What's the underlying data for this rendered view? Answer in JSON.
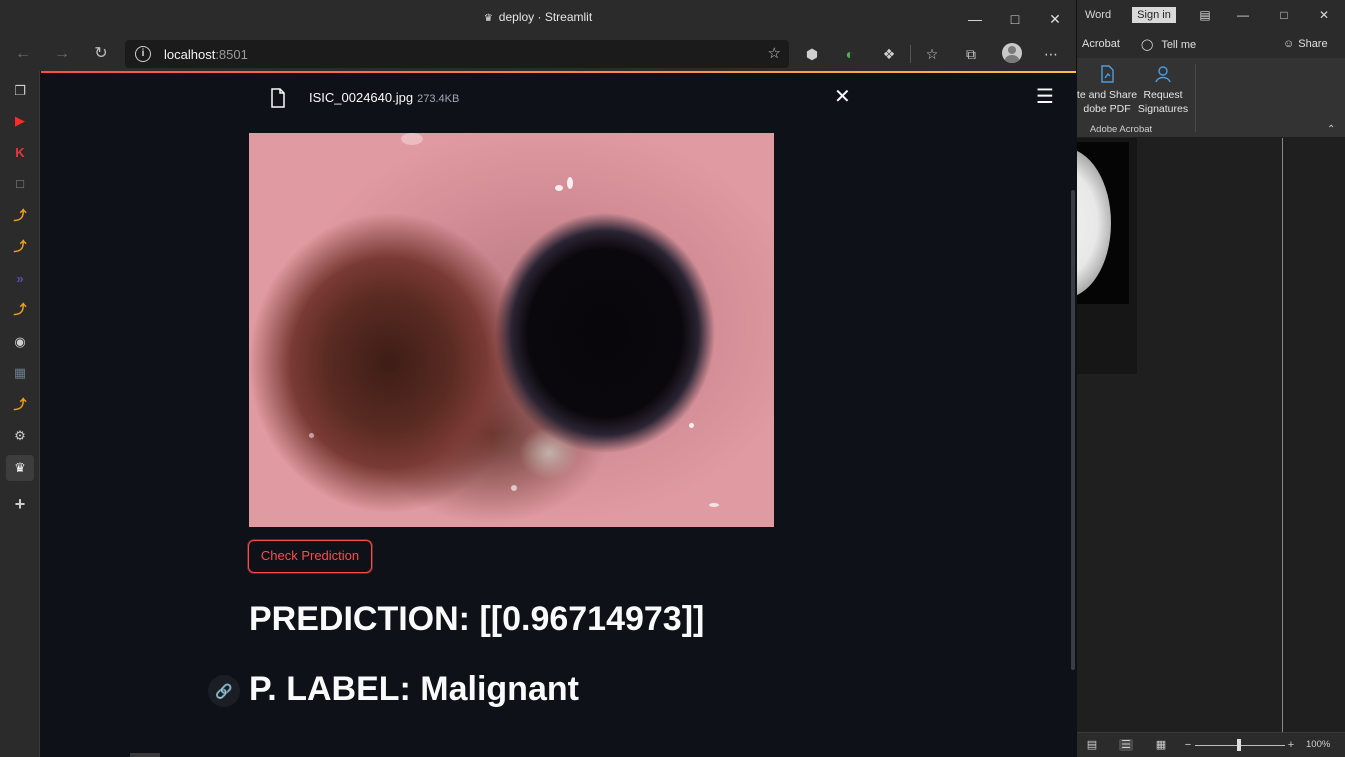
{
  "browser": {
    "tab_title": "deploy · Streamlit",
    "url_host": "localhost",
    "url_port": ":8501"
  },
  "app": {
    "file_name": "ISIC_0024640.jpg",
    "file_size": "273.4KB",
    "button_label": "Check Prediction",
    "prediction_heading": "PREDICTION: [[0.96714973]]",
    "label_heading": "P. LABEL: Malignant"
  },
  "word": {
    "app_name": "Word",
    "sign_in": "Sign in",
    "tabs": [
      "Acrobat",
      "Tell me",
      "Share"
    ],
    "ribbon": {
      "create_share_line1": "te and Share",
      "create_share_line2": "dobe PDF",
      "request_line1": "Request",
      "request_line2": "Signatures",
      "group_label": "Adobe Acrobat"
    },
    "zoom": "100%"
  },
  "colors": {
    "accent": "#ff4b4b",
    "background": "#0e1117",
    "chrome": "#2b2b2b"
  }
}
